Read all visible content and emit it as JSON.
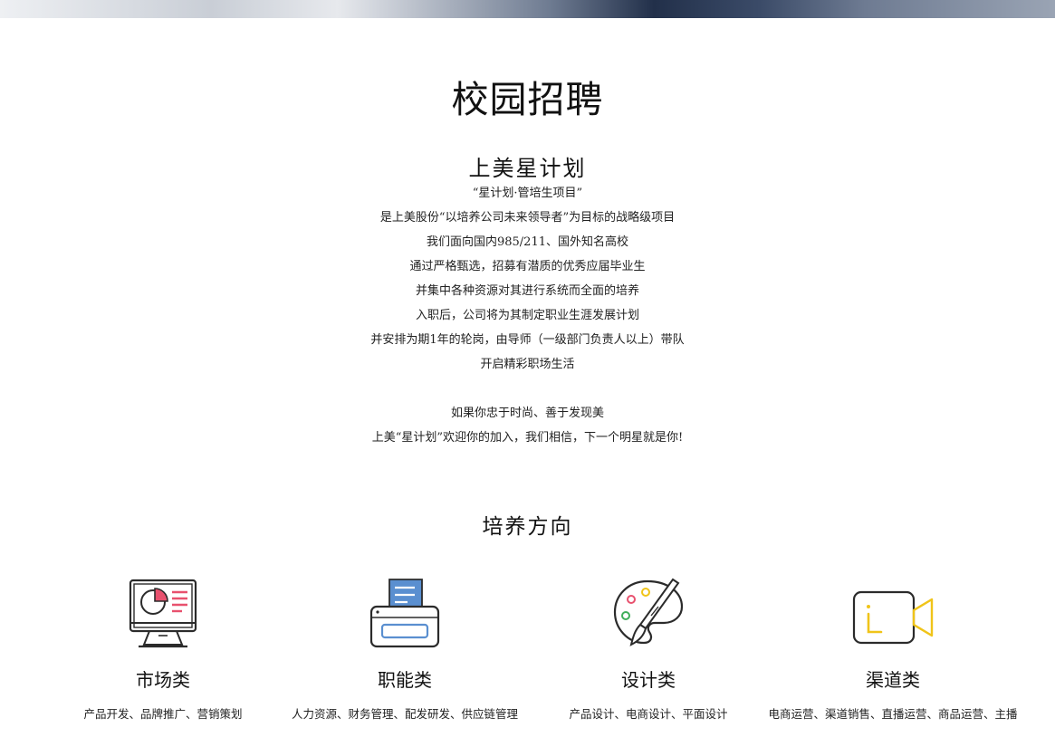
{
  "page": {
    "title": "校园招聘",
    "section_title": "上美星计划",
    "intro_lines": [
      "“星计划·管培生项目”",
      "是上美股份“以培养公司未来领导者”为目标的战略级项目",
      "我们面向国内985/211、国外知名高校",
      "通过严格甄选，招募有潜质的优秀应届毕业生",
      "并集中各种资源对其进行系统而全面的培养",
      "入职后，公司将为其制定职业生涯发展计划",
      "并安排为期1年的轮岗，由导师（一级部门负责人以上）带队",
      "开启精彩职场生活"
    ],
    "closing_lines": [
      "如果你忠于时尚、善于发现美",
      "上美“星计划”欢迎你的加入，我们相信，下一个明星就是你!"
    ],
    "directions_title": "培养方向"
  },
  "categories": [
    {
      "icon": "presentation-chart-icon",
      "name": "市场类",
      "desc": "产品开发、品牌推广、营销策划"
    },
    {
      "icon": "printer-icon",
      "name": "职能类",
      "desc": "人力资源、财务管理、配发研发、供应链管理"
    },
    {
      "icon": "palette-brush-icon",
      "name": "设计类",
      "desc": "产品设计、电商设计、平面设计"
    },
    {
      "icon": "video-camera-icon",
      "name": "渠道类",
      "desc": "电商运营、渠道销售、直播运营、商品运营、主播"
    }
  ],
  "colors": {
    "accent_pink": "#e8516e",
    "accent_blue": "#5a8fd0",
    "accent_yellow": "#f0c419",
    "accent_green": "#3fae5a",
    "stroke": "#2b2b2b"
  }
}
